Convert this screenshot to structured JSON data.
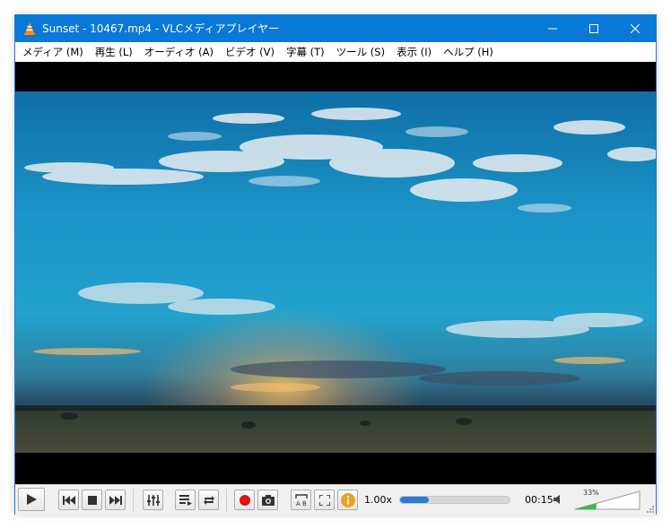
{
  "window": {
    "title": "Sunset - 10467.mp4 - VLCメディアプレイヤー",
    "accent_color": "#0a78d7",
    "controls": [
      "minimize-icon",
      "maximize-icon",
      "close-icon"
    ]
  },
  "menu": {
    "items": [
      {
        "label": "メディア (M)"
      },
      {
        "label": "再生 (L)"
      },
      {
        "label": "オーディオ (A)"
      },
      {
        "label": "ビデオ (V)"
      },
      {
        "label": "字幕 (T)"
      },
      {
        "label": "ツール (S)"
      },
      {
        "label": "表示 (I)"
      },
      {
        "label": "ヘルプ (H)"
      }
    ]
  },
  "video": {
    "content": "sunset-sky-landscape-frame"
  },
  "controls": {
    "buttons": [
      {
        "name": "play",
        "icon": "play-icon"
      },
      {
        "name": "previous",
        "icon": "skip-back-icon"
      },
      {
        "name": "stop",
        "icon": "stop-icon"
      },
      {
        "name": "next",
        "icon": "skip-forward-icon"
      },
      {
        "name": "extended-settings",
        "icon": "equalizer-icon"
      },
      {
        "name": "playlist",
        "icon": "playlist-icon"
      },
      {
        "name": "loop",
        "icon": "loop-icon"
      },
      {
        "name": "record",
        "icon": "record-icon",
        "color": "#e01010"
      },
      {
        "name": "snapshot",
        "icon": "camera-icon"
      },
      {
        "name": "ab-loop",
        "icon": "ab-loop-icon"
      },
      {
        "name": "fullscreen",
        "icon": "fullscreen-icon"
      },
      {
        "name": "info",
        "icon": "info-icon",
        "color": "#f0a020"
      }
    ],
    "speed": "1.00x",
    "progress": 0.26,
    "time": "00:15",
    "volume_label": "33%",
    "volume_level": 0.33
  }
}
